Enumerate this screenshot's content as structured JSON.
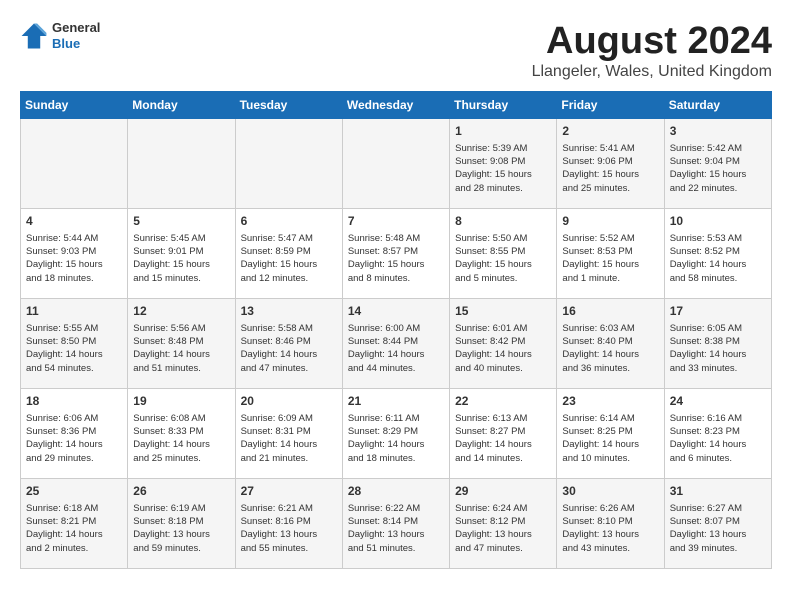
{
  "header": {
    "logo": {
      "general": "General",
      "blue": "Blue"
    },
    "month": "August 2024",
    "location": "Llangeler, Wales, United Kingdom"
  },
  "days_of_week": [
    "Sunday",
    "Monday",
    "Tuesday",
    "Wednesday",
    "Thursday",
    "Friday",
    "Saturday"
  ],
  "weeks": [
    [
      {
        "day": "",
        "info": ""
      },
      {
        "day": "",
        "info": ""
      },
      {
        "day": "",
        "info": ""
      },
      {
        "day": "",
        "info": ""
      },
      {
        "day": "1",
        "info": "Sunrise: 5:39 AM\nSunset: 9:08 PM\nDaylight: 15 hours\nand 28 minutes."
      },
      {
        "day": "2",
        "info": "Sunrise: 5:41 AM\nSunset: 9:06 PM\nDaylight: 15 hours\nand 25 minutes."
      },
      {
        "day": "3",
        "info": "Sunrise: 5:42 AM\nSunset: 9:04 PM\nDaylight: 15 hours\nand 22 minutes."
      }
    ],
    [
      {
        "day": "4",
        "info": "Sunrise: 5:44 AM\nSunset: 9:03 PM\nDaylight: 15 hours\nand 18 minutes."
      },
      {
        "day": "5",
        "info": "Sunrise: 5:45 AM\nSunset: 9:01 PM\nDaylight: 15 hours\nand 15 minutes."
      },
      {
        "day": "6",
        "info": "Sunrise: 5:47 AM\nSunset: 8:59 PM\nDaylight: 15 hours\nand 12 minutes."
      },
      {
        "day": "7",
        "info": "Sunrise: 5:48 AM\nSunset: 8:57 PM\nDaylight: 15 hours\nand 8 minutes."
      },
      {
        "day": "8",
        "info": "Sunrise: 5:50 AM\nSunset: 8:55 PM\nDaylight: 15 hours\nand 5 minutes."
      },
      {
        "day": "9",
        "info": "Sunrise: 5:52 AM\nSunset: 8:53 PM\nDaylight: 15 hours\nand 1 minute."
      },
      {
        "day": "10",
        "info": "Sunrise: 5:53 AM\nSunset: 8:52 PM\nDaylight: 14 hours\nand 58 minutes."
      }
    ],
    [
      {
        "day": "11",
        "info": "Sunrise: 5:55 AM\nSunset: 8:50 PM\nDaylight: 14 hours\nand 54 minutes."
      },
      {
        "day": "12",
        "info": "Sunrise: 5:56 AM\nSunset: 8:48 PM\nDaylight: 14 hours\nand 51 minutes."
      },
      {
        "day": "13",
        "info": "Sunrise: 5:58 AM\nSunset: 8:46 PM\nDaylight: 14 hours\nand 47 minutes."
      },
      {
        "day": "14",
        "info": "Sunrise: 6:00 AM\nSunset: 8:44 PM\nDaylight: 14 hours\nand 44 minutes."
      },
      {
        "day": "15",
        "info": "Sunrise: 6:01 AM\nSunset: 8:42 PM\nDaylight: 14 hours\nand 40 minutes."
      },
      {
        "day": "16",
        "info": "Sunrise: 6:03 AM\nSunset: 8:40 PM\nDaylight: 14 hours\nand 36 minutes."
      },
      {
        "day": "17",
        "info": "Sunrise: 6:05 AM\nSunset: 8:38 PM\nDaylight: 14 hours\nand 33 minutes."
      }
    ],
    [
      {
        "day": "18",
        "info": "Sunrise: 6:06 AM\nSunset: 8:36 PM\nDaylight: 14 hours\nand 29 minutes."
      },
      {
        "day": "19",
        "info": "Sunrise: 6:08 AM\nSunset: 8:33 PM\nDaylight: 14 hours\nand 25 minutes."
      },
      {
        "day": "20",
        "info": "Sunrise: 6:09 AM\nSunset: 8:31 PM\nDaylight: 14 hours\nand 21 minutes."
      },
      {
        "day": "21",
        "info": "Sunrise: 6:11 AM\nSunset: 8:29 PM\nDaylight: 14 hours\nand 18 minutes."
      },
      {
        "day": "22",
        "info": "Sunrise: 6:13 AM\nSunset: 8:27 PM\nDaylight: 14 hours\nand 14 minutes."
      },
      {
        "day": "23",
        "info": "Sunrise: 6:14 AM\nSunset: 8:25 PM\nDaylight: 14 hours\nand 10 minutes."
      },
      {
        "day": "24",
        "info": "Sunrise: 6:16 AM\nSunset: 8:23 PM\nDaylight: 14 hours\nand 6 minutes."
      }
    ],
    [
      {
        "day": "25",
        "info": "Sunrise: 6:18 AM\nSunset: 8:21 PM\nDaylight: 14 hours\nand 2 minutes."
      },
      {
        "day": "26",
        "info": "Sunrise: 6:19 AM\nSunset: 8:18 PM\nDaylight: 13 hours\nand 59 minutes."
      },
      {
        "day": "27",
        "info": "Sunrise: 6:21 AM\nSunset: 8:16 PM\nDaylight: 13 hours\nand 55 minutes."
      },
      {
        "day": "28",
        "info": "Sunrise: 6:22 AM\nSunset: 8:14 PM\nDaylight: 13 hours\nand 51 minutes."
      },
      {
        "day": "29",
        "info": "Sunrise: 6:24 AM\nSunset: 8:12 PM\nDaylight: 13 hours\nand 47 minutes."
      },
      {
        "day": "30",
        "info": "Sunrise: 6:26 AM\nSunset: 8:10 PM\nDaylight: 13 hours\nand 43 minutes."
      },
      {
        "day": "31",
        "info": "Sunrise: 6:27 AM\nSunset: 8:07 PM\nDaylight: 13 hours\nand 39 minutes."
      }
    ]
  ]
}
